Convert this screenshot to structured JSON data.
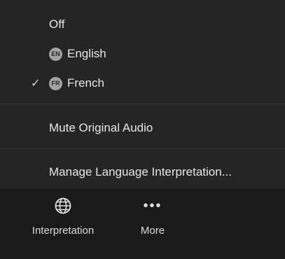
{
  "menu": {
    "items": [
      {
        "label": "Off",
        "checked": false,
        "badge": ""
      },
      {
        "label": "English",
        "checked": false,
        "badge": "EN"
      },
      {
        "label": "French",
        "checked": true,
        "badge": "FR"
      }
    ],
    "check_glyph": "✓",
    "mute_label": "Mute Original Audio",
    "manage_label": "Manage Language Interpretation..."
  },
  "toolbar": {
    "interpretation_label": "Interpretation",
    "interpretation_icon": "globe-icon",
    "more_label": "More",
    "more_icon": "more-dots-icon",
    "more_glyph": "•••"
  },
  "colors": {
    "menu_bg": "#252525",
    "toolbar_bg": "#1a1a1a",
    "text": "#e6e6e6",
    "badge_bg": "#a3a3a3"
  }
}
